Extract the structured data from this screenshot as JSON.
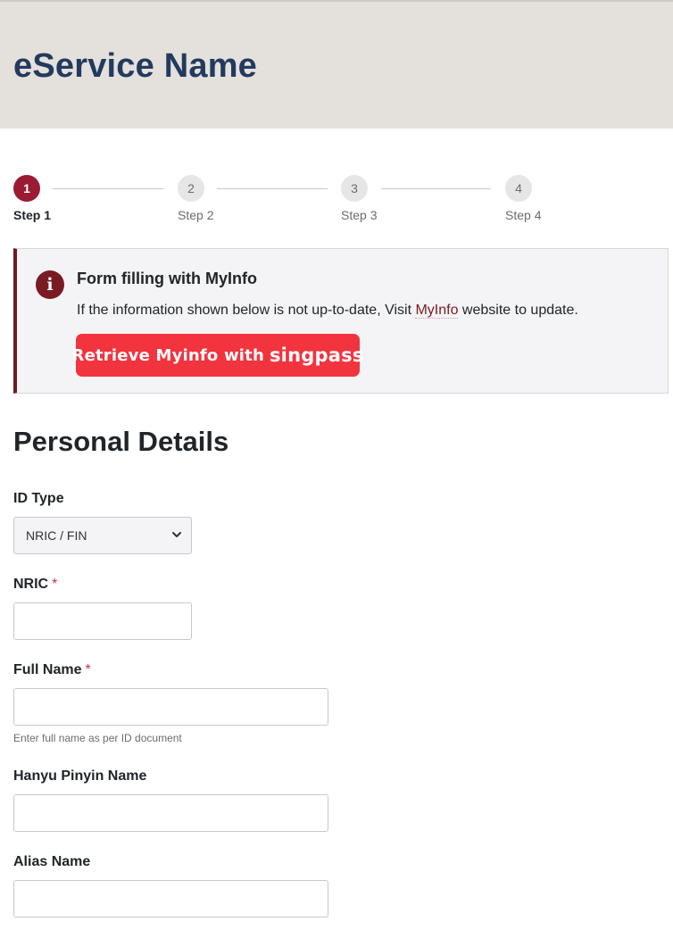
{
  "header": {
    "title": "eService Name"
  },
  "stepper": {
    "steps": [
      {
        "number": "1",
        "label": "Step 1",
        "active": true
      },
      {
        "number": "2",
        "label": "Step 2",
        "active": false
      },
      {
        "number": "3",
        "label": "Step 3",
        "active": false
      },
      {
        "number": "4",
        "label": "Step 4",
        "active": false
      }
    ]
  },
  "alert": {
    "icon": "info-icon",
    "icon_glyph": "i",
    "title": "Form filling with MyInfo",
    "text_before": "If the information shown below is not up-to-date, Visit ",
    "link_text": "MyInfo",
    "text_after": " website to update.",
    "button_prefix": "Retrieve Myinfo with",
    "button_brand": "singpass",
    "accent_color": "#6e1a22",
    "button_color": "#f2343f"
  },
  "form": {
    "section_title": "Personal Details",
    "required_mark": "*",
    "id_type": {
      "label": "ID Type",
      "value": "NRIC / FIN"
    },
    "nric": {
      "label": "NRIC",
      "value": ""
    },
    "full_name": {
      "label": "Full Name",
      "value": "",
      "hint": "Enter full name as per ID document"
    },
    "hanyu_pinyin": {
      "label": "Hanyu Pinyin Name",
      "value": ""
    },
    "alias": {
      "label": "Alias Name",
      "value": ""
    }
  }
}
